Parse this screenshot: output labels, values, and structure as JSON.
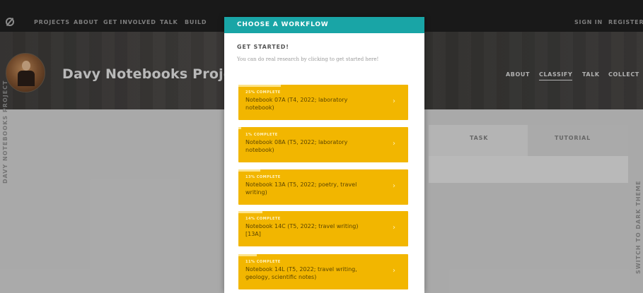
{
  "topnav": {
    "items": [
      "PROJECTS",
      "ABOUT",
      "GET INVOLVED",
      "TALK",
      "BUILD"
    ],
    "sign_in": "SIGN IN",
    "register": "REGISTER"
  },
  "project": {
    "title": "Davy Notebooks Projec",
    "nav": [
      "ABOUT",
      "CLASSIFY",
      "TALK",
      "COLLECT"
    ],
    "active_nav": "CLASSIFY"
  },
  "sidebar": {
    "left_text": "DAVY NOTEBOOKS PROJECT",
    "right_text": "SWITCH TO DARK THEME"
  },
  "tabs": {
    "task": "TASK",
    "tutorial": "TUTORIAL"
  },
  "dialog": {
    "title": "CHOOSE A WORKFLOW",
    "subtitle": "GET STARTED!",
    "intro": "You can do real research by clicking to get started here!",
    "workflows": [
      {
        "percent_label": "25% COMPLETE",
        "progress": 0.25,
        "name": "Notebook 07A (T4, 2022; laboratory notebook)"
      },
      {
        "percent_label": "1% COMPLETE",
        "progress": 0.01,
        "name": "Notebook 08A (T5, 2022; laboratory notebook)"
      },
      {
        "percent_label": "13% COMPLETE",
        "progress": 0.13,
        "name": "Notebook 13A (T5, 2022; poetry, travel writing)"
      },
      {
        "percent_label": "14% COMPLETE",
        "progress": 0.14,
        "name": "Notebook 14C (T5, 2022; travel writing) [13A]"
      },
      {
        "percent_label": "11% COMPLETE",
        "progress": 0.11,
        "name": "Notebook 14L (T5, 2022; travel writing, geology, scientific notes)"
      }
    ]
  },
  "colors": {
    "header_teal": "#19a5a6",
    "workflow_yellow": "#f2b600",
    "topnav_bg": "#1f1f1f"
  }
}
